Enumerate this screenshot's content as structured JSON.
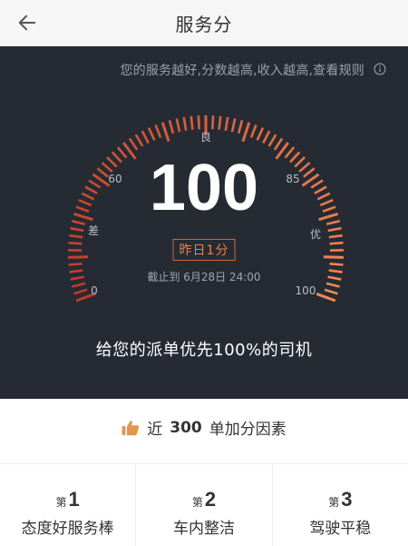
{
  "header": {
    "title": "服务分",
    "back_icon": "arrow-left-icon"
  },
  "rule_text": "您的服务越好,分数越高,收入越高,查看规则",
  "gauge": {
    "score": "100",
    "score_value": 100,
    "min": 0,
    "max": 100,
    "labels": {
      "min": "0",
      "max": "100",
      "poor": "差",
      "mark60": "60",
      "good": "良",
      "mark85": "85",
      "excellent": "优"
    },
    "delta": "昨日1分",
    "deadline": "截止到 6月28日 24:00",
    "colors": {
      "start": "#c0392b",
      "end": "#f28b54",
      "track": "#3a3f47"
    }
  },
  "priority_text": "给您的派单优先100%的司机",
  "factors_section": {
    "title_prefix": "近",
    "title_bold": "300",
    "title_suffix": "单加分因素",
    "icon": "thumbs-up-icon",
    "items": [
      {
        "rank_prefix": "第",
        "rank": "1",
        "name": "态度好服务棒"
      },
      {
        "rank_prefix": "第",
        "rank": "2",
        "name": "车内整洁"
      },
      {
        "rank_prefix": "第",
        "rank": "3",
        "name": "驾驶平稳"
      }
    ]
  }
}
